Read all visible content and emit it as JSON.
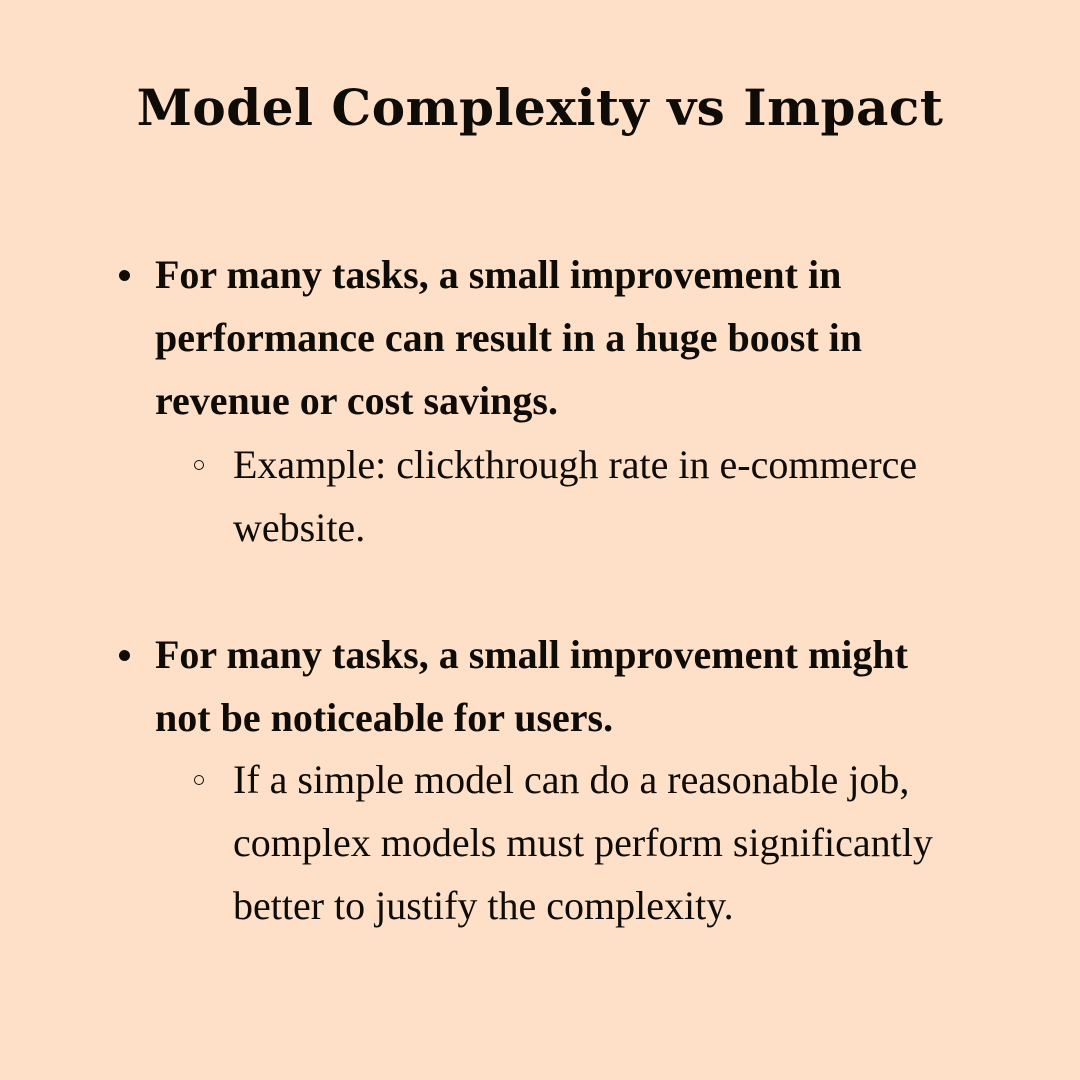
{
  "title": "Model Complexity vs Impact",
  "bullets": [
    {
      "text": "For many tasks, a small improvement in performance can result in a huge boost in revenue or cost savings.",
      "sub": "Example: clickthrough rate in e-commerce website."
    },
    {
      "text": "For many tasks, a small improvement might not be noticeable for users.",
      "sub": "If a simple model can do a reasonable job, complex models must perform significantly better to justify the complexity."
    }
  ]
}
